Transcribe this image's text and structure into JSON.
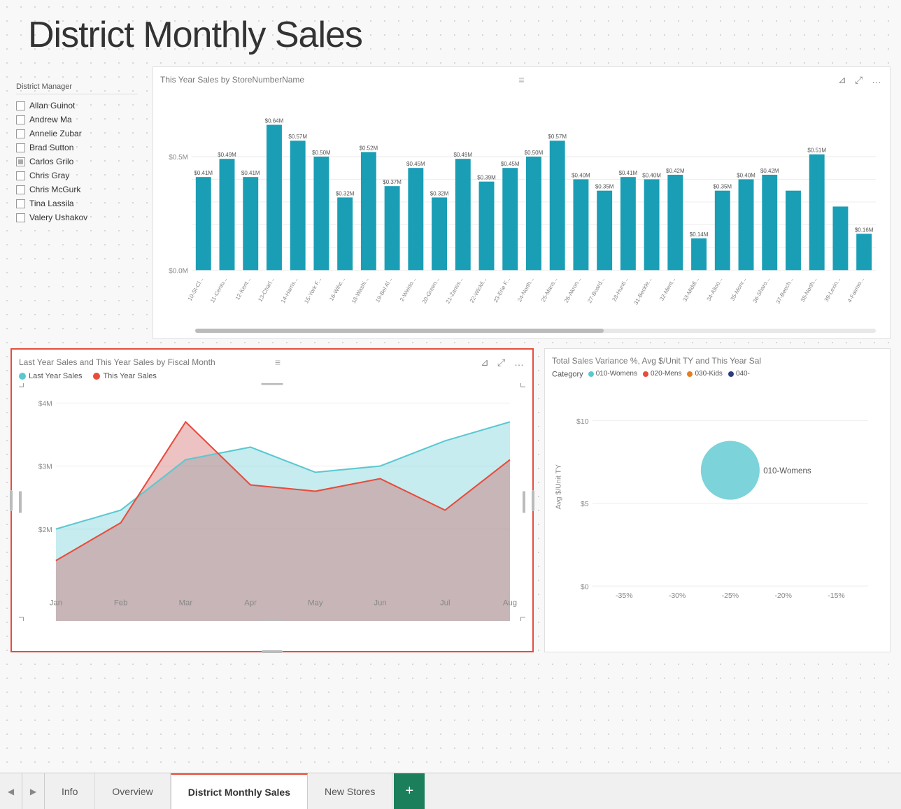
{
  "page": {
    "title": "District Monthly Sales",
    "background": "#f8f8f8"
  },
  "slicer": {
    "title": "District Manager",
    "items": [
      {
        "label": "Allan Guinot",
        "checked": false,
        "partial": false
      },
      {
        "label": "Andrew Ma",
        "checked": false,
        "partial": false
      },
      {
        "label": "Annelie Zubar",
        "checked": false,
        "partial": false
      },
      {
        "label": "Brad Sutton",
        "checked": false,
        "partial": false
      },
      {
        "label": "Carlos Grilo",
        "checked": false,
        "partial": true
      },
      {
        "label": "Chris Gray",
        "checked": false,
        "partial": false
      },
      {
        "label": "Chris McGurk",
        "checked": false,
        "partial": false
      },
      {
        "label": "Tina Lassila",
        "checked": false,
        "partial": false
      },
      {
        "label": "Valery Ushakov",
        "checked": false,
        "partial": false
      }
    ]
  },
  "bar_chart": {
    "title": "This Year Sales by StoreNumberName",
    "y_axis": [
      "$0.5M",
      "$0.0M"
    ],
    "bars": [
      {
        "label": "10-St-Cl...",
        "value": 0.41,
        "display": "$0.41M"
      },
      {
        "label": "11-Centu...",
        "value": 0.49,
        "display": "$0.49M"
      },
      {
        "label": "12-Kent...",
        "value": 0.41,
        "display": "$0.41M"
      },
      {
        "label": "13-Charl...",
        "value": 0.64,
        "display": "$0.64M"
      },
      {
        "label": "14-Harris...",
        "value": 0.57,
        "display": "$0.57M"
      },
      {
        "label": "15-York F...",
        "value": 0.5,
        "display": "$0.50M"
      },
      {
        "label": "16-Wihc...",
        "value": 0.32,
        "display": "$0.32M"
      },
      {
        "label": "18-Washi...",
        "value": 0.52,
        "display": "$0.52M"
      },
      {
        "label": "19-Bel Al...",
        "value": 0.37,
        "display": "$0.37M"
      },
      {
        "label": "2-Weirto...",
        "value": 0.45,
        "display": "$0.45M"
      },
      {
        "label": "20-Green...",
        "value": 0.32,
        "display": "$0.32M"
      },
      {
        "label": "21-Zanes...",
        "value": 0.49,
        "display": "$0.49M"
      },
      {
        "label": "22-Wickli...",
        "value": 0.39,
        "display": "$0.39M"
      },
      {
        "label": "23-Erie F...",
        "value": 0.45,
        "display": "$0.45M"
      },
      {
        "label": "24-North...",
        "value": 0.5,
        "display": "$0.50M"
      },
      {
        "label": "25-Mans...",
        "value": 0.57,
        "display": "$0.57M"
      },
      {
        "label": "26-Akron...",
        "value": 0.4,
        "display": "$0.40M"
      },
      {
        "label": "27-Board...",
        "value": 0.35,
        "display": "$0.35M"
      },
      {
        "label": "28-Hunti...",
        "value": 0.41,
        "display": "$0.41M"
      },
      {
        "label": "31-Beckle...",
        "value": 0.4,
        "display": "$0.40M"
      },
      {
        "label": "32-Ment...",
        "value": 0.42,
        "display": "$0.42M"
      },
      {
        "label": "33-Middl...",
        "value": 0.14,
        "display": "$0.14M"
      },
      {
        "label": "34-Altoo...",
        "value": 0.35,
        "display": "$0.35M"
      },
      {
        "label": "35-Monr...",
        "value": 0.4,
        "display": "$0.40M"
      },
      {
        "label": "36-Sharo...",
        "value": 0.42,
        "display": "$0.42M"
      },
      {
        "label": "37-Beech...",
        "value": 0.35,
        "display": ""
      },
      {
        "label": "38-North...",
        "value": 0.51,
        "display": "$0.51M"
      },
      {
        "label": "39-Lexin...",
        "value": 0.28,
        "display": ""
      },
      {
        "label": "4-Fairmo...",
        "value": 0.16,
        "display": "$0.16M"
      }
    ]
  },
  "line_chart": {
    "title": "Last Year Sales and This Year Sales by Fiscal Month",
    "legend": [
      {
        "label": "Last Year Sales",
        "color": "#5bc8d0"
      },
      {
        "label": "This Year Sales",
        "color": "#e74c3c"
      }
    ],
    "y_axis": [
      "$4M",
      "$3M",
      "$2M"
    ],
    "x_axis": [
      "Jan",
      "Feb",
      "Mar",
      "Apr",
      "May",
      "Jun",
      "Jul",
      "Aug"
    ],
    "last_year_data": [
      2.0,
      2.3,
      3.1,
      3.3,
      2.9,
      3.0,
      3.4,
      3.7
    ],
    "this_year_data": [
      1.5,
      2.1,
      3.7,
      2.7,
      2.6,
      2.8,
      2.3,
      3.1
    ]
  },
  "scatter_chart": {
    "title": "Total Sales Variance %, Avg $/Unit TY and This Year Sal",
    "category_label": "Category",
    "categories": [
      {
        "label": "010-Womens",
        "color": "#5bc8d0"
      },
      {
        "label": "020-Mens",
        "color": "#e74c3c"
      },
      {
        "label": "030-Kids",
        "color": "#e67e22"
      },
      {
        "label": "040-",
        "color": "#2c3e80"
      }
    ],
    "y_axis_label": "Avg $/Unit TY",
    "y_axis": [
      "$10",
      "$5",
      "$0"
    ],
    "x_axis": [
      "-30%",
      "-20%"
    ],
    "bubble": {
      "label": "010-Womens",
      "x": -25,
      "y": 7,
      "size": 40
    }
  },
  "tabs": [
    {
      "label": "Info",
      "active": false
    },
    {
      "label": "Overview",
      "active": false
    },
    {
      "label": "District Monthly Sales",
      "active": true
    },
    {
      "label": "New Stores",
      "active": false
    }
  ],
  "tab_add_label": "+",
  "icons": {
    "filter": "⊿",
    "expand": "⤢",
    "more": "…",
    "drag": "≡",
    "nav_left": "◀",
    "nav_right": "▶"
  }
}
